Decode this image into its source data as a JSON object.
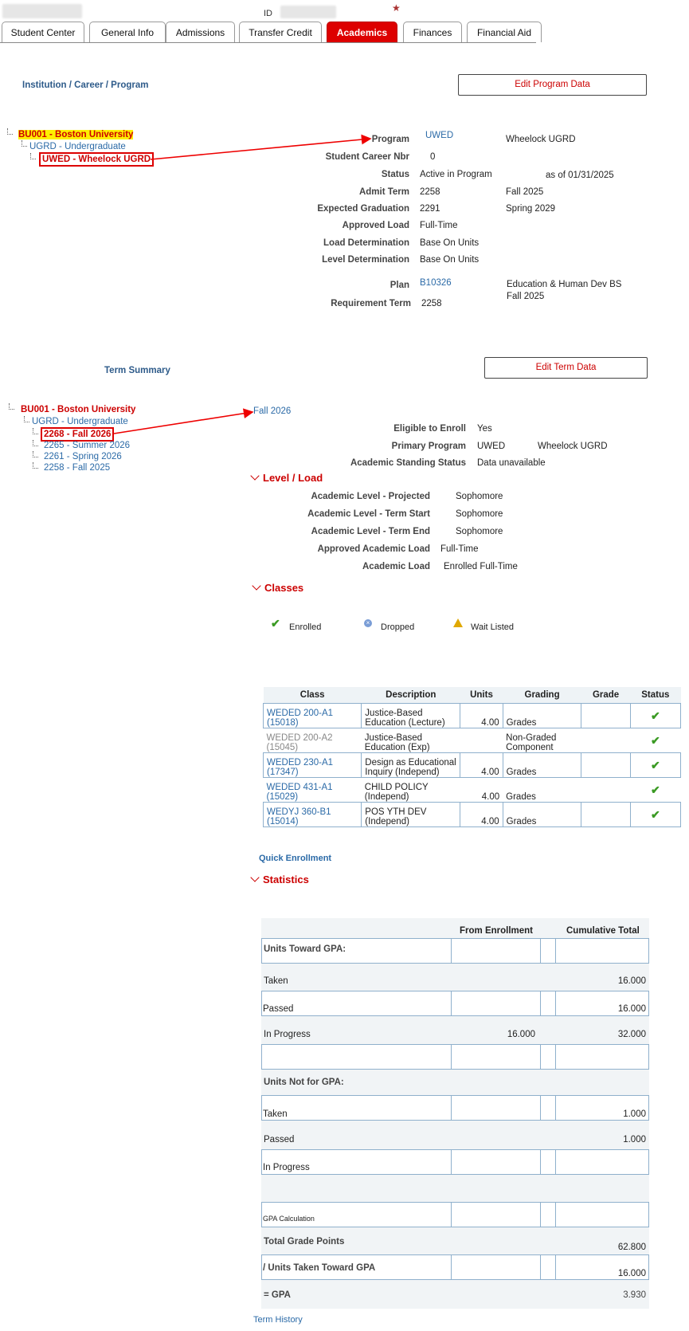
{
  "header": {
    "id_label": "ID",
    "star": "★"
  },
  "tabs": [
    {
      "label": "Student Center",
      "active": false
    },
    {
      "label": "General Info",
      "active": false
    },
    {
      "label": "Admissions",
      "active": false
    },
    {
      "label": "Transfer Credit",
      "active": false
    },
    {
      "label": "Academics",
      "active": true
    },
    {
      "label": "Finances",
      "active": false
    },
    {
      "label": "Financial Aid",
      "active": false
    }
  ],
  "program_section": {
    "title": "Institution / Career / Program",
    "edit_button": "Edit Program Data",
    "tree": {
      "institution": "BU001 - Boston University",
      "career": "UGRD - Undergraduate",
      "program": "UWED - Wheelock UGRD"
    },
    "fields": {
      "program_label": "Program",
      "program_code": "UWED",
      "program_desc": "Wheelock UGRD",
      "career_nbr_label": "Student Career Nbr",
      "career_nbr": "0",
      "status_label": "Status",
      "status": "Active in Program",
      "status_asof": "as of 01/31/2025",
      "admit_label": "Admit Term",
      "admit_code": "2258",
      "admit_desc": "Fall 2025",
      "grad_label": "Expected Graduation",
      "grad_code": "2291",
      "grad_desc": "Spring 2029",
      "load_label": "Approved Load",
      "load": "Full-Time",
      "loaddet_label": "Load Determination",
      "loaddet": "Base On Units",
      "leveldet_label": "Level Determination",
      "leveldet": "Base On Units",
      "plan_label": "Plan",
      "plan_code": "B10326",
      "plan_desc": "Education & Human Dev BS",
      "plan_term_desc": "Fall 2025",
      "req_label": "Requirement Term",
      "req_term": "2258"
    }
  },
  "term_section": {
    "title": "Term Summary",
    "edit_button": "Edit Term Data",
    "tree": {
      "institution": "BU001 - Boston University",
      "career": "UGRD - Undergraduate",
      "terms": [
        "2268 - Fall 2026",
        "2265 - Summer 2026",
        "2261 - Spring 2026",
        "2258 - Fall 2025"
      ]
    },
    "selected_term": "Fall 2026",
    "eligible_label": "Eligible to Enroll",
    "eligible": "Yes",
    "primary_label": "Primary Program",
    "primary_code": "UWED",
    "primary_desc": "Wheelock UGRD",
    "standing_label": "Academic Standing Status",
    "standing": "Data unavailable"
  },
  "level_load": {
    "title": "Level / Load",
    "rows": [
      {
        "label": "Academic Level - Projected",
        "value": "Sophomore"
      },
      {
        "label": "Academic Level - Term Start",
        "value": "Sophomore"
      },
      {
        "label": "Academic Level - Term End",
        "value": "Sophomore"
      },
      {
        "label": "Approved Academic Load",
        "value": "Full-Time"
      },
      {
        "label": "Academic Load",
        "value": "Enrolled Full-Time"
      }
    ]
  },
  "classes": {
    "title": "Classes",
    "legend": {
      "enrolled": "Enrolled",
      "dropped": "Dropped",
      "waitlisted": "Wait Listed"
    },
    "headers": [
      "Class",
      "Description",
      "Units",
      "Grading",
      "Grade",
      "Status"
    ],
    "rows": [
      {
        "cls1": "WEDED 200-A1",
        "cls2": "(15018)",
        "desc": "Justice-Based Education (Lecture)",
        "units": "4.00",
        "grading": "Grades",
        "grade": "",
        "link": true
      },
      {
        "cls1": "WEDED 200-A2",
        "cls2": "(15045)",
        "desc": "Justice-Based Education (Exp)",
        "units": "",
        "grading": "Non-Graded Component",
        "grade": "",
        "link": false
      },
      {
        "cls1": "WEDED 230-A1",
        "cls2": "(17347)",
        "desc": "Design as Educational Inquiry (Independ)",
        "units": "4.00",
        "grading": "Grades",
        "grade": "",
        "link": true
      },
      {
        "cls1": "WEDED 431-A1",
        "cls2": "(15029)",
        "desc": "CHILD POLICY (Independ)",
        "units": "4.00",
        "grading": "Grades",
        "grade": "",
        "link": true
      },
      {
        "cls1": "WEDYJ 360-B1",
        "cls2": "(15014)",
        "desc": "POS YTH DEV (Independ)",
        "units": "4.00",
        "grading": "Grades",
        "grade": "",
        "link": true
      }
    ],
    "quick_enrollment": "Quick Enrollment"
  },
  "statistics": {
    "title": "Statistics",
    "col_enroll": "From Enrollment",
    "col_cum": "Cumulative Total",
    "units_gpa": "Units Toward GPA:",
    "taken": "Taken",
    "taken_cum": "16.000",
    "passed": "Passed",
    "passed_cum": "16.000",
    "inprog": "In Progress",
    "inprog_enroll": "16.000",
    "inprog_cum": "32.000",
    "units_not_gpa": "Units Not for GPA:",
    "taken2": "Taken",
    "taken2_cum": "1.000",
    "passed2": "Passed",
    "passed2_cum": "1.000",
    "inprog2": "In Progress",
    "gpa_calc": "GPA Calculation",
    "total_points": "Total Grade Points",
    "total_points_cum": "62.800",
    "units_taken": "/  Units Taken Toward GPA",
    "units_taken_cum": "16.000",
    "gpa": "= GPA",
    "gpa_cum": "3.930"
  },
  "term_history": "Term History"
}
